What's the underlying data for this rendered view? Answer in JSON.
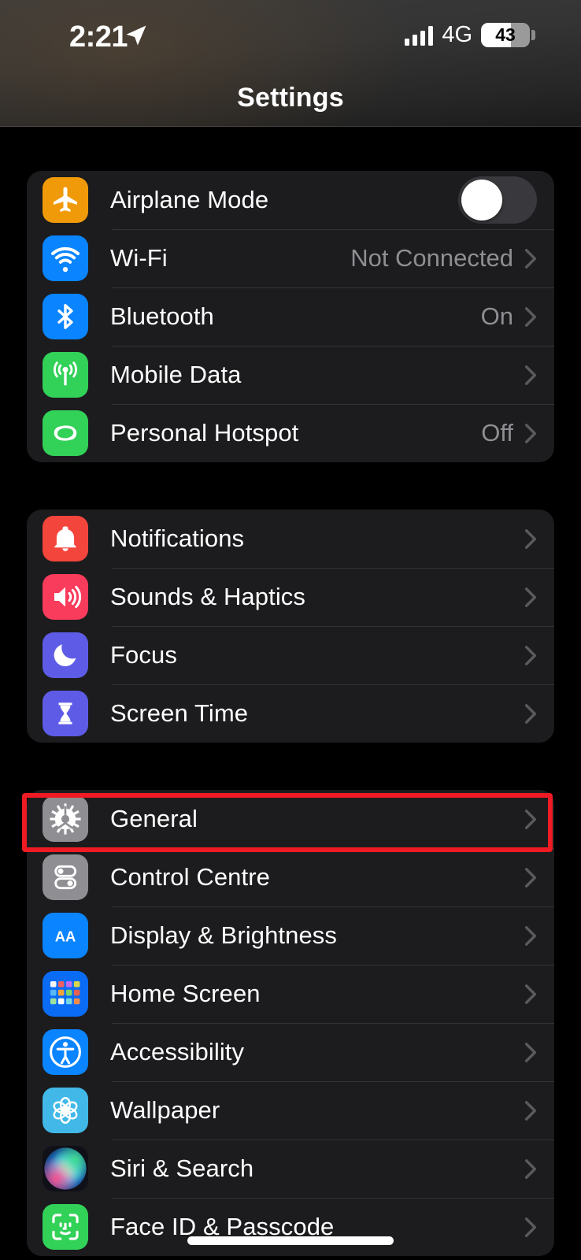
{
  "status_bar": {
    "time": "2:21",
    "location_icon": "location-arrow-icon",
    "signal_icon": "cellular-signal-icon",
    "network": "4G",
    "battery_percent": "43",
    "battery_level": 62
  },
  "nav": {
    "title": "Settings"
  },
  "highlight": {
    "target": "General",
    "color": "#EE1B24"
  },
  "groups": [
    {
      "name": "connectivity",
      "rows": [
        {
          "label": "Airplane Mode",
          "value": "",
          "icon": "airplane-icon",
          "icon_color": "#F09A0A",
          "control": "toggle",
          "toggle_on": false
        },
        {
          "label": "Wi-Fi",
          "value": "Not Connected",
          "icon": "wifi-icon",
          "icon_color": "#0A84FF",
          "control": "chevron"
        },
        {
          "label": "Bluetooth",
          "value": "On",
          "icon": "bluetooth-icon",
          "icon_color": "#0A84FF",
          "control": "chevron"
        },
        {
          "label": "Mobile Data",
          "value": "",
          "icon": "antenna-icon",
          "icon_color": "#32D158",
          "control": "chevron"
        },
        {
          "label": "Personal Hotspot",
          "value": "Off",
          "icon": "hotspot-link-icon",
          "icon_color": "#32D158",
          "control": "chevron"
        }
      ]
    },
    {
      "name": "alerts",
      "rows": [
        {
          "label": "Notifications",
          "value": "",
          "icon": "bell-icon",
          "icon_color": "#F4453C",
          "control": "chevron"
        },
        {
          "label": "Sounds & Haptics",
          "value": "",
          "icon": "speaker-icon",
          "icon_color": "#F93B5C",
          "control": "chevron"
        },
        {
          "label": "Focus",
          "value": "",
          "icon": "moon-icon",
          "icon_color": "#5E5CE6",
          "control": "chevron"
        },
        {
          "label": "Screen Time",
          "value": "",
          "icon": "hourglass-icon",
          "icon_color": "#5E5CE6",
          "control": "chevron"
        }
      ]
    },
    {
      "name": "system",
      "rows": [
        {
          "label": "General",
          "value": "",
          "icon": "gear-icon",
          "icon_color": "#8E8E93",
          "control": "chevron"
        },
        {
          "label": "Control Centre",
          "value": "",
          "icon": "control-centre-toggles-icon",
          "icon_color": "#8E8E93",
          "control": "chevron"
        },
        {
          "label": "Display & Brightness",
          "value": "",
          "icon": "text-size-aa-icon",
          "icon_color": "#0A84FF",
          "control": "chevron"
        },
        {
          "label": "Home Screen",
          "value": "",
          "icon": "app-grid-icon",
          "icon_color": "#0A6CF5",
          "control": "chevron"
        },
        {
          "label": "Accessibility",
          "value": "",
          "icon": "accessibility-person-icon",
          "icon_color": "#0A84FF",
          "control": "chevron"
        },
        {
          "label": "Wallpaper",
          "value": "",
          "icon": "flower-icon",
          "icon_color": "#41B8E8",
          "control": "chevron"
        },
        {
          "label": "Siri & Search",
          "value": "",
          "icon": "siri-orb-icon",
          "icon_color": "#C2255C",
          "control": "chevron"
        },
        {
          "label": "Face ID & Passcode",
          "value": "",
          "icon": "face-id-icon",
          "icon_color": "#32D158",
          "control": "chevron"
        }
      ]
    }
  ]
}
